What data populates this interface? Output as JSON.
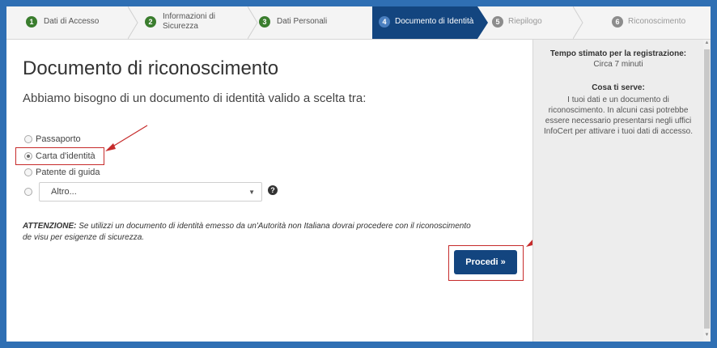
{
  "steps": [
    {
      "num": "1",
      "label": "Dati di Accesso",
      "state": "done"
    },
    {
      "num": "2",
      "label_line1": "Informazioni di",
      "label_line2": "Sicurezza",
      "state": "done"
    },
    {
      "num": "3",
      "label": "Dati Personali",
      "state": "done"
    },
    {
      "num": "4",
      "label": "Documento di Identità",
      "state": "active"
    },
    {
      "num": "5",
      "label": "Riepilogo",
      "state": "todo"
    },
    {
      "num": "6",
      "label": "Riconoscimento",
      "state": "todo"
    }
  ],
  "main": {
    "title": "Documento di riconoscimento",
    "subtitle": "Abbiamo bisogno di un documento di identità valido a scelta tra:",
    "options": [
      {
        "label": "Passaporto",
        "selected": false
      },
      {
        "label": "Carta d'identità",
        "selected": true
      },
      {
        "label": "Patente di guida",
        "selected": false
      }
    ],
    "other_select_value": "Altro...",
    "help_glyph": "?",
    "warning_label": "ATTENZIONE:",
    "warning_text": " Se utilizzi un documento di identità emesso da un'Autorità non Italiana dovrai procedere con il riconoscimento de visu per esigenze di sicurezza.",
    "proceed_label": "Procedi »"
  },
  "sidebar": {
    "time_heading": "Tempo stimato per la registrazione:",
    "time_value": "Circa 7 minuti",
    "needs_heading": "Cosa ti serve:",
    "needs_text": "I tuoi dati e un documento di riconoscimento. In alcuni casi potrebbe essere necessario presentarsi negli uffici InfoCert per attivare i tuoi dati di accesso."
  },
  "colors": {
    "accent": "#13457f",
    "done_step": "#3a7d2e",
    "annotation": "#c62b2b",
    "background": "#2f6fb3"
  }
}
